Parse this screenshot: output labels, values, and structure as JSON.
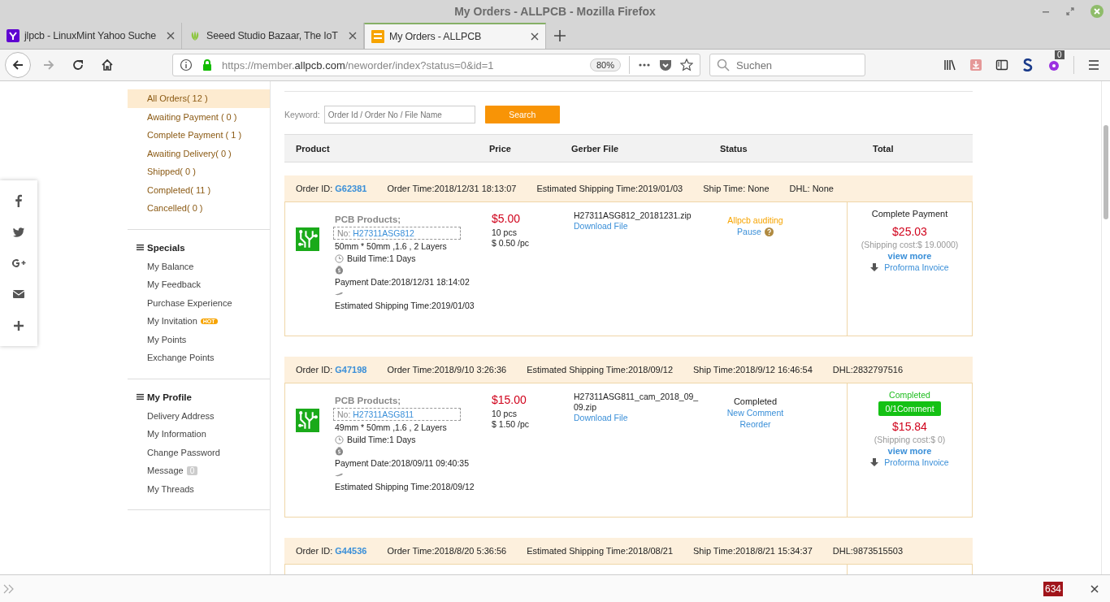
{
  "window": {
    "title": "My Orders - ALLPCB - Mozilla Firefox"
  },
  "tabs": [
    {
      "label": "jlpcb - LinuxMint Yahoo Suche",
      "selected": false
    },
    {
      "label": "Seeed Studio Bazaar, The IoT",
      "selected": false
    },
    {
      "label": "My Orders - ALLPCB",
      "selected": true
    }
  ],
  "address_bar": {
    "url_prefix": "https://member.",
    "url_domain": "allpcb.com",
    "url_path": "/neworder/index?status=0&id=1",
    "zoom": "80%"
  },
  "search": {
    "placeholder": "Suchen"
  },
  "extension_badge": "0",
  "sidebar": [
    {
      "items": [
        {
          "label": "All Orders( 12 )",
          "selected": true
        },
        {
          "label": "Awaiting Payment ( 0 )",
          "selected": false
        },
        {
          "label": "Complete Payment ( 1 )",
          "selected": false
        },
        {
          "label": "Awaiting Delivery( 0 )",
          "selected": false
        },
        {
          "label": "Shipped( 0 )",
          "selected": false
        },
        {
          "label": "Completed( 11 )",
          "selected": false
        },
        {
          "label": "Cancelled( 0 )",
          "selected": false
        }
      ]
    },
    {
      "title": "Specials",
      "items": [
        {
          "label": "My Balance",
          "selected": false
        },
        {
          "label": "My Feedback",
          "selected": false
        },
        {
          "label": "Purchase Experience",
          "selected": false
        },
        {
          "label": "My Invitation",
          "selected": false,
          "badge": "HOT",
          "kind": "hot"
        },
        {
          "label": "My Points",
          "selected": false
        },
        {
          "label": "Exchange Points",
          "selected": false
        }
      ]
    },
    {
      "title": "My Profile",
      "items": [
        {
          "label": "Delivery Address",
          "selected": false
        },
        {
          "label": "My Information",
          "selected": false
        },
        {
          "label": "Change Password",
          "selected": false
        },
        {
          "label": "Message",
          "selected": false,
          "badge": "0",
          "kind": "count"
        },
        {
          "label": "My Threads",
          "selected": false
        }
      ]
    }
  ],
  "filter": {
    "label": "Keyword:",
    "placeholder": "Order Id / Order No / File Name",
    "button": "Search"
  },
  "table": {
    "columns": [
      "Product",
      "Price",
      "Gerber File",
      "Status",
      "Total"
    ]
  },
  "orders": [
    {
      "id_label": "Order ID:",
      "id": "G62381",
      "order_time": "Order Time:2018/12/31 18:13:07",
      "est_time": "Estimated Shipping Time:2019/01/03",
      "ship_time": "Ship Time: None",
      "dhl": "DHL: None",
      "product": {
        "title": "PCB Products;",
        "no_label": "No:",
        "no": "H27311ASG812",
        "size": "50mm * 50mm ,1.6 , 2 Layers",
        "build_time": "Build Time:1 Days",
        "payment_date": "Payment Date:2018/12/31 18:14:02",
        "est_shipping": "Estimated Shipping Time:2019/01/03"
      },
      "price": "$5.00",
      "qty": "10 pcs",
      "unit_price": "$ 0.50 /pc",
      "file": "H27311ASG812_20181231.zip",
      "download": "Download File",
      "status": [
        {
          "kind": "warning",
          "text": "Allpcb auditing"
        },
        {
          "kind": "help-link",
          "text": "Pause"
        }
      ],
      "total": [
        {
          "kind": "label",
          "text": "Complete Payment"
        },
        {
          "kind": "price",
          "text": "$25.03"
        },
        {
          "kind": "note",
          "text": "(Shipping cost:$ 19.0000)"
        },
        {
          "kind": "more",
          "text": "view more"
        },
        {
          "kind": "invoice",
          "text": "Proforma Invoice"
        }
      ]
    },
    {
      "id_label": "Order ID:",
      "id": "G47198",
      "order_time": "Order Time:2018/9/10 3:26:36",
      "est_time": "Estimated Shipping Time:2018/09/12",
      "ship_time": "Ship Time:2018/9/12 16:46:54",
      "dhl": "DHL:2832797516",
      "product": {
        "title": "PCB Products;",
        "no_label": "No:",
        "no": "H27311ASG811",
        "size": "49mm * 50mm ,1.6 , 2 Layers",
        "build_time": "Build Time:1 Days",
        "payment_date": "Payment Date:2018/09/11 09:40:35",
        "est_shipping": "Estimated Shipping Time:2018/09/12"
      },
      "price": "$15.00",
      "qty": "10 pcs",
      "unit_price": "$ 1.50 /pc",
      "file": "H27311ASG811_cam_2018_09_09.zip",
      "download": "Download File",
      "status": [
        {
          "kind": "text",
          "text": "Completed"
        },
        {
          "kind": "link",
          "text": "New Comment"
        },
        {
          "kind": "link",
          "text": "Reorder"
        }
      ],
      "total": [
        {
          "kind": "done",
          "text": "Completed"
        },
        {
          "kind": "comment-button",
          "text": "0/1Comment"
        },
        {
          "kind": "price",
          "text": "$15.84"
        },
        {
          "kind": "note",
          "text": "(Shipping cost:$ 0)"
        },
        {
          "kind": "more",
          "text": "view more"
        },
        {
          "kind": "invoice",
          "text": "Proforma Invoice"
        }
      ]
    },
    {
      "id_label": "Order ID:",
      "id": "G44536",
      "order_time": "Order Time:2018/8/20 5:36:56",
      "est_time": "Estimated Shipping Time:2018/08/21",
      "ship_time": "Ship Time:2018/8/21 15:34:37",
      "dhl": "DHL:9873515503"
    }
  ],
  "findbar": {
    "counter": "634"
  }
}
